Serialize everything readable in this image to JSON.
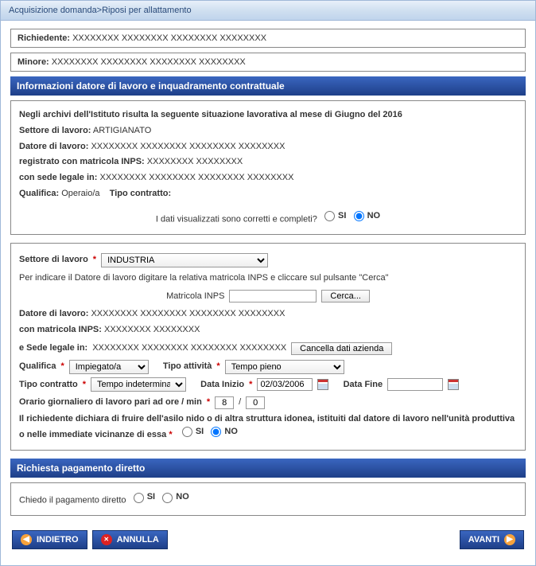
{
  "titlebar": "Acquisizione domanda>Riposi per allattamento",
  "richiedente": {
    "label": "Richiedente:",
    "value": "XXXXXXXX   XXXXXXXX  XXXXXXXX   XXXXXXXX"
  },
  "minore": {
    "label": "Minore:",
    "value": "XXXXXXXX   XXXXXXXX  XXXXXXXX   XXXXXXXX"
  },
  "section1_title": "Informazioni datore di lavoro e inquadramento contrattuale",
  "archivio": {
    "intro": "Negli archivi dell'Istituto risulta la seguente situazione lavorativa al mese di Giugno del 2016",
    "settore_label": "Settore di lavoro:",
    "settore_value": "ARTIGIANATO",
    "datore_label": "Datore di lavoro:",
    "datore_value": "XXXXXXXX   XXXXXXXX  XXXXXXXX   XXXXXXXX",
    "registrato_label": "registrato con matricola INPS:",
    "registrato_value": "XXXXXXXX   XXXXXXXX",
    "sede_label": "con sede legale in:",
    "sede_value": "XXXXXXXX   XXXXXXXX  XXXXXXXX   XXXXXXXX",
    "qualifica_label": "Qualifica:",
    "qualifica_value": "Operaio/a",
    "tipocontratto_label": "Tipo contratto:",
    "confirm_question": "I dati visualizzati sono corretti e completi?",
    "si": "SI",
    "no": "NO"
  },
  "form": {
    "settore_label": "Settore di lavoro",
    "settore_value": "INDUSTRIA",
    "helper": "Per indicare il Datore di lavoro digitare la relativa matricola INPS e cliccare sul pulsante \"Cerca\"",
    "matricola_label": "Matricola INPS",
    "cerca_btn": "Cerca...",
    "datore_label": "Datore di lavoro:",
    "datore_value": "XXXXXXXX   XXXXXXXX  XXXXXXXX   XXXXXXXX",
    "conmatricola_label": "con matricola INPS:",
    "conmatricola_value": "XXXXXXXX   XXXXXXXX",
    "sede_label": "e Sede legale in:",
    "sede_value": "XXXXXXXX   XXXXXXXX  XXXXXXXX   XXXXXXXX",
    "cancella_btn": "Cancella dati azienda",
    "qualifica_label": "Qualifica",
    "qualifica_value": "Impiegato/a",
    "tipoattivita_label": "Tipo attività",
    "tipoattivita_value": "Tempo pieno",
    "tipocontratto_label": "Tipo contratto",
    "tipocontratto_value": "Tempo indeterminato",
    "datainizio_label": "Data Inizio",
    "datainizio_value": "02/03/2006",
    "datafine_label": "Data Fine",
    "datafine_value": "",
    "orario_label": "Orario giornaliero di lavoro pari ad ore / min",
    "orario_ore": "8",
    "orario_sep": "/",
    "orario_min": "0",
    "asilo_text": "Il richiedente dichiara di fruire dell'asilo nido o di altra struttura idonea, istituiti dal datore di lavoro nell'unità produttiva o nelle immediate vicinanze di essa",
    "si": "SI",
    "no": "NO"
  },
  "section2_title": "Richiesta pagamento diretto",
  "pagamento": {
    "label": "Chiedo il pagamento diretto",
    "si": "SI",
    "no": "NO"
  },
  "buttons": {
    "indietro": "INDIETRO",
    "annulla": "ANNULLA",
    "avanti": "AVANTI"
  }
}
